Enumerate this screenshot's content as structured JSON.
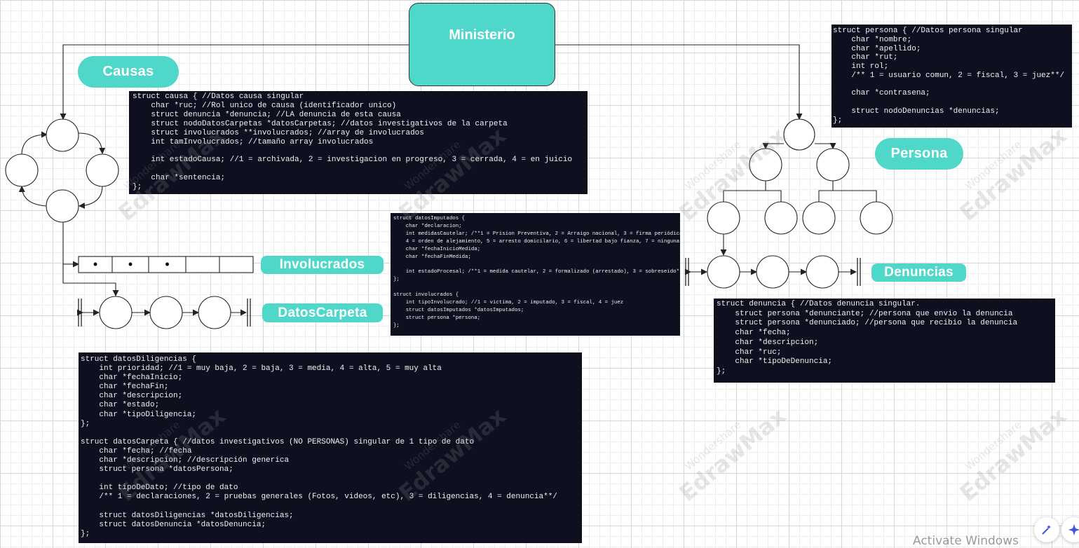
{
  "nodes": {
    "ministerio": "Ministerio",
    "causas": "Causas",
    "persona": "Persona",
    "involucrados": "Involucrados",
    "datosCarpeta": "DatosCarpeta",
    "denuncias": "Denuncias"
  },
  "array_cells": [
    "•",
    "•",
    "•",
    "",
    ""
  ],
  "code": {
    "persona": "struct persona { //Datos persona singular\n    char *nombre;\n    char *apellido;\n    char *rut;\n    int rol;\n    /** 1 = usuario comun, 2 = fiscal, 3 = juez**/\n\n    char *contrasena;\n\n    struct nodoDenuncias *denuncias;\n};",
    "causa": "struct causa { //Datos causa singular\n    char *ruc; //Rol unico de causa (identificador unico)\n    struct denuncia *denuncia; //LA denuncia de esta causa\n    struct nodoDatosCarpetas *datosCarpetas; //datos investigativos de la carpeta\n    struct involucrados **involucrados; //array de involucrados\n    int tamInvolucrados; //tamaño array involucrados\n\n    int estadoCausa; //1 = archivada, 2 = investigacion en progreso, 3 = cerrada, 4 = en juicio\n\n    char *sentencia;\n};",
    "imputados": "struct datosImputados {\n    char *declaracion;\n    int medidasCautelar; /**1 = Prision Preventiva, 2 = Arraigo nacional, 3 = firma periódica,\n    4 = orden de alejamiento, 5 = arresto domicilario, 6 = libertad bajo fianza, 7 = ninguna**/\n    char *fechaInicioMedida;\n    char *fechaFinMedida;\n\n    int estadoProcesal; /**1 = medida cautelar, 2 = formalizado (arrestado), 3 = sobreseido**/\n};\n\nstruct involucrados {\n    int tipoInvolucrado; //1 = victima, 2 = imputado, 3 = fiscal, 4 = juez\n    struct datosImputados *datosImputados;\n    struct persona *persona;\n};",
    "denuncia": "struct denuncia { //Datos denuncia singular.\n    struct persona *denunciante; //persona que envio la denuncia\n    struct persona *denunciado; //persona que recibio la denuncia\n    char *fecha;\n    char *descripcion;\n    char *ruc;\n    char *tipoDeDenuncia;\n};",
    "diligencias": "struct datosDiligencias {\n    int prioridad; //1 = muy baja, 2 = baja, 3 = media, 4 = alta, 5 = muy alta\n    char *fechaInicio;\n    char *fechaFin;\n    char *descripcion;\n    char *estado;\n    char *tipoDiligencia;\n};\n\nstruct datosCarpeta { //datos investigativos (NO PERSONAS) singular de 1 tipo de dato\n    char *fecha; //fecha\n    char *descripcion; //descripción generica\n    struct persona *datosPersona;\n\n    int tipoDeDato; //tipo de dato\n    /** 1 = declaraciones, 2 = pruebas generales (Fotos, videos, etc), 3 = diligencias, 4 = denuncia**/\n\n    struct datosDiligencias *datosDiligencias;\n    struct datosDenuncia *datosDenuncia;\n};"
  },
  "watermark": {
    "top": "Wondershare",
    "bottom": "EdrawMax"
  },
  "system": {
    "activate": "Activate Windows"
  },
  "colors": {
    "accent": "#4fd8c9",
    "code_bg": "#0e0f1f",
    "line": "#222222"
  }
}
